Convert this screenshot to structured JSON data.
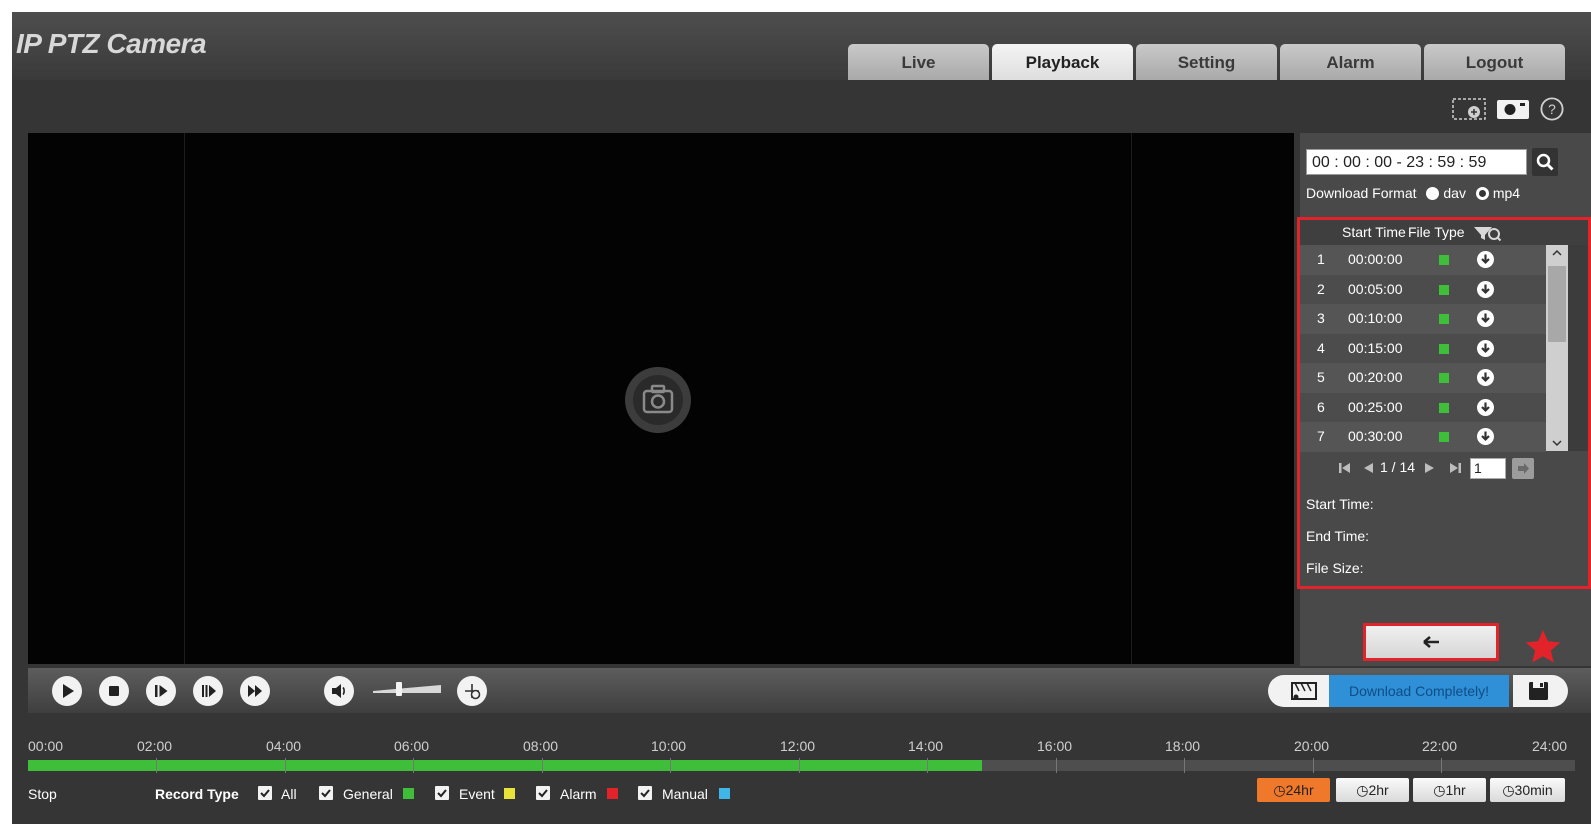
{
  "app": {
    "title": "IP PTZ Camera"
  },
  "nav": {
    "tabs": [
      {
        "label": "Live",
        "active": false
      },
      {
        "label": "Playback",
        "active": true
      },
      {
        "label": "Setting",
        "active": false
      },
      {
        "label": "Alarm",
        "active": false
      },
      {
        "label": "Logout",
        "active": false
      }
    ]
  },
  "toolbar": {
    "icons": [
      "region-zoom-icon",
      "snapshot-icon",
      "help-icon"
    ]
  },
  "search": {
    "time_range": "00 : 00 : 00 -  23 : 59 : 59",
    "download_format_label": "Download Format",
    "format_options": [
      {
        "label": "dav",
        "selected": true
      },
      {
        "label": "mp4",
        "selected": false
      }
    ]
  },
  "file_list": {
    "headers": {
      "start_time": "Start Time",
      "file_type": "File Type"
    },
    "rows": [
      {
        "index": "1",
        "start_time": "00:00:00"
      },
      {
        "index": "2",
        "start_time": "00:05:00"
      },
      {
        "index": "3",
        "start_time": "00:10:00"
      },
      {
        "index": "4",
        "start_time": "00:15:00"
      },
      {
        "index": "5",
        "start_time": "00:20:00"
      },
      {
        "index": "6",
        "start_time": "00:25:00"
      },
      {
        "index": "7",
        "start_time": "00:30:00"
      }
    ],
    "file_type_color": "#3fbe39",
    "pagination": {
      "text": "1 / 14",
      "page_input": "1"
    },
    "details": {
      "start_time_label": "Start Time:",
      "end_time_label": "End Time:",
      "file_size_label": "File Size:"
    }
  },
  "download": {
    "status": "Download Completely!"
  },
  "timeline": {
    "labels": [
      "00:00",
      "02:00",
      "04:00",
      "06:00",
      "08:00",
      "10:00",
      "12:00",
      "14:00",
      "16:00",
      "18:00",
      "20:00",
      "22:00",
      "24:00"
    ],
    "recorded_until_hours": 14.8,
    "status": "Stop",
    "record_type_label": "Record Type",
    "record_types": [
      {
        "label": "All",
        "color": ""
      },
      {
        "label": "General",
        "color": "#3fbe39"
      },
      {
        "label": "Event",
        "color": "#e8e23a"
      },
      {
        "label": "Alarm",
        "color": "#e3232a"
      },
      {
        "label": "Manual",
        "color": "#3fb6e6"
      }
    ],
    "zoom_options": [
      {
        "label": "24hr",
        "active": true
      },
      {
        "label": "2hr",
        "active": false
      },
      {
        "label": "1hr",
        "active": false
      },
      {
        "label": "30min",
        "active": false
      }
    ]
  },
  "colors": {
    "accent_red": "#e3232a",
    "active_orange": "#f0782a",
    "record_green": "#3fbe39",
    "status_blue": "#2f8fd7"
  }
}
